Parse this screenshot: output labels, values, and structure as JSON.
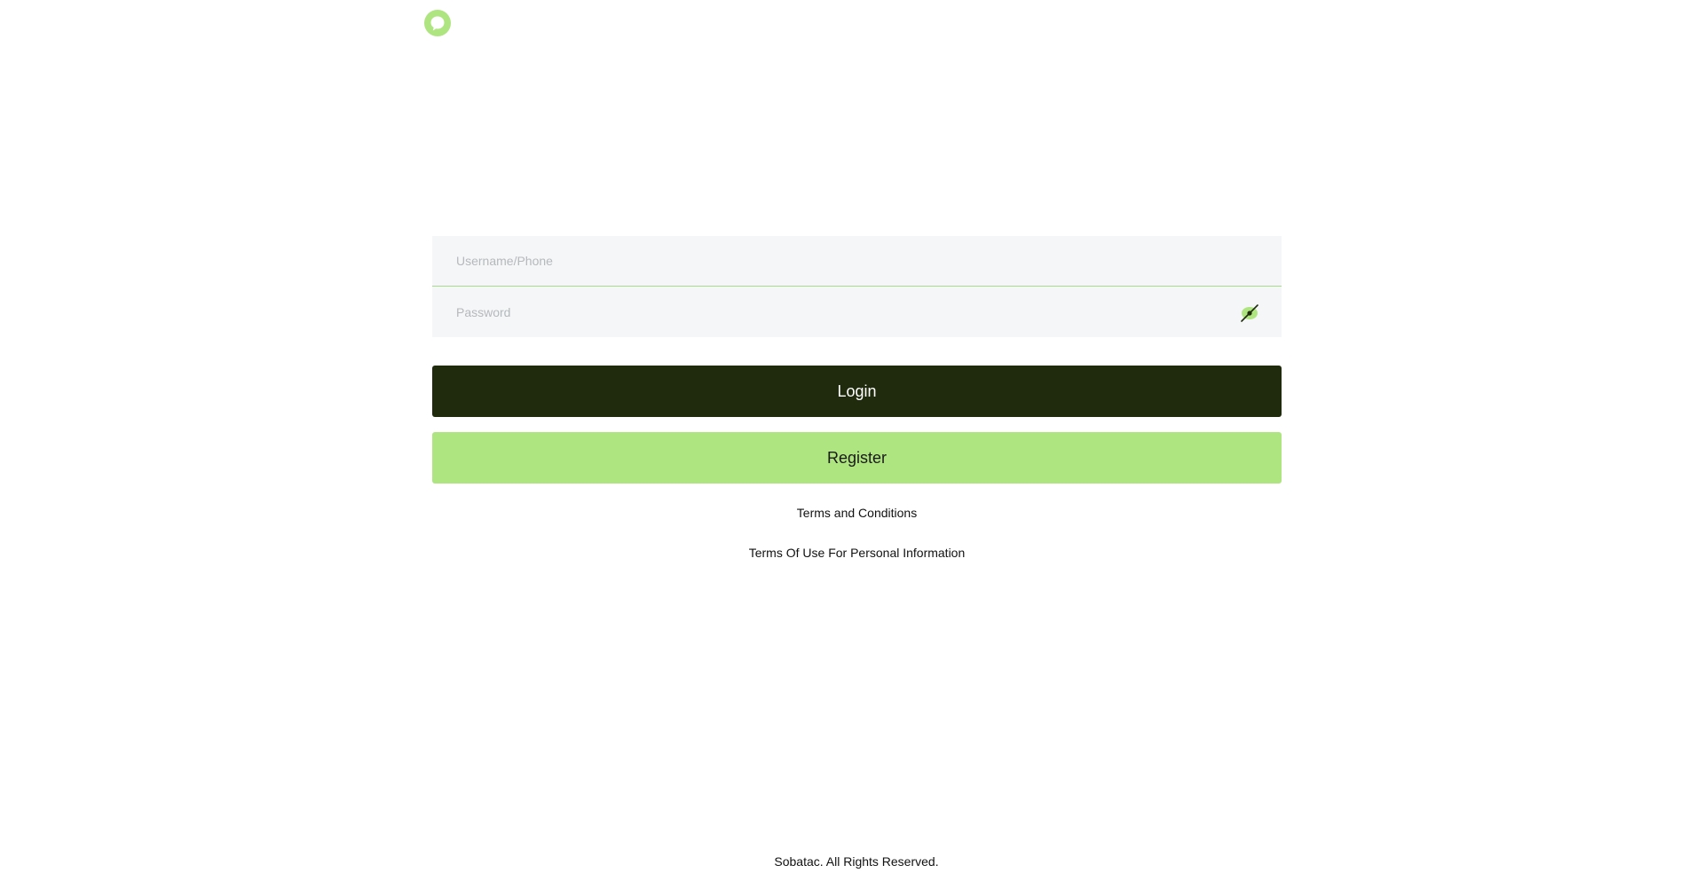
{
  "brand": {
    "logo_icon": "chat-bubble-icon",
    "accent_color": "#aee581",
    "dark_color": "#1f2b0c"
  },
  "login_form": {
    "username_placeholder": "Username/Phone",
    "password_placeholder": "Password",
    "password_toggle_icon": "eye-slash-icon",
    "login_label": "Login",
    "register_label": "Register"
  },
  "links": {
    "terms": "Terms and Conditions",
    "privacy": "Terms Of Use For Personal Information"
  },
  "footer": {
    "copyright": "Sobatac. All Rights Reserved."
  }
}
